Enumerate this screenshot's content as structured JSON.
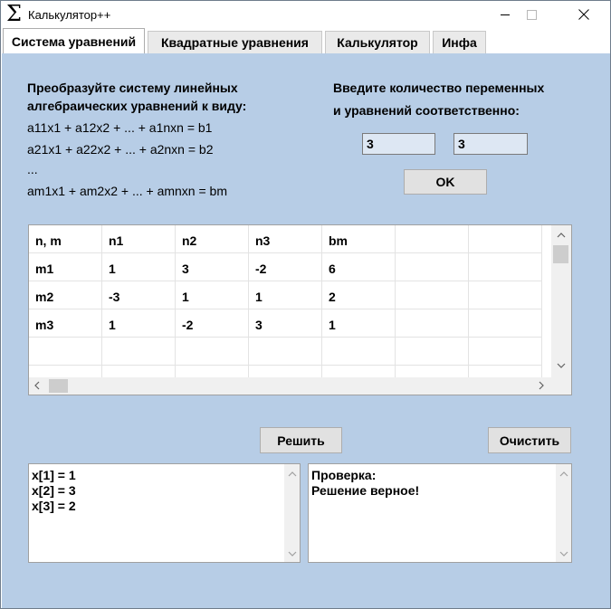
{
  "window": {
    "title": "Калькулятор++",
    "icon_glyph": "Σ"
  },
  "tabs": [
    {
      "label": "Система уравнений",
      "active": true
    },
    {
      "label": "Квадратные уравнения",
      "active": false
    },
    {
      "label": "Калькулятор",
      "active": false
    },
    {
      "label": "Инфа",
      "active": false
    }
  ],
  "instructions": {
    "line1": "Преобразуйте систему линейных",
    "line2": "алгебраических уравнений к виду:",
    "eq1": "a11x1 + a12x2 + ... + a1nxn = b1",
    "eq2": "a21x1 + a22x2 + ... + a2nxn = b2",
    "dots": "...",
    "eq3": "am1x1 + am2x2 + ... + amnxn = bm"
  },
  "dimensions": {
    "label_line1": "Введите количество переменных",
    "label_line2": "и уравнений соответственно:",
    "vars_value": "3",
    "eqs_value": "3",
    "ok_label": "OK"
  },
  "grid": {
    "columns": [
      "n, m",
      "n1",
      "n2",
      "n3",
      "bm",
      "",
      ""
    ],
    "rows": [
      [
        "m1",
        "1",
        "3",
        "-2",
        "6",
        "",
        ""
      ],
      [
        "m2",
        "-3",
        "1",
        "1",
        "2",
        "",
        ""
      ],
      [
        "m3",
        "1",
        "-2",
        "3",
        "1",
        "",
        ""
      ],
      [
        "",
        "",
        "",
        "",
        "",
        "",
        ""
      ],
      [
        "",
        "",
        "",
        "",
        "",
        "",
        ""
      ]
    ]
  },
  "actions": {
    "solve_label": "Решить",
    "clear_label": "Очистить"
  },
  "output": {
    "result_text": "x[1] = 1\nx[2] = 3\nx[3] = 2",
    "check_text": "Проверка:\nРешение верное!"
  },
  "colors": {
    "panel_bg": "#b7cde6",
    "input_bg": "#dde7f3",
    "button_bg": "#e1e1e1"
  }
}
